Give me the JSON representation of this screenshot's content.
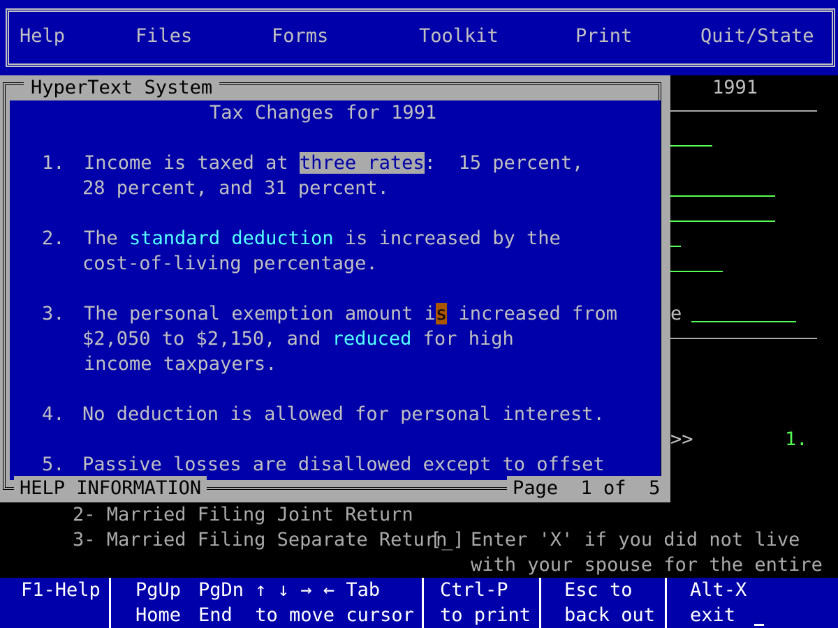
{
  "menu": {
    "items": [
      {
        "label": "Help"
      },
      {
        "label": "Files"
      },
      {
        "label": "Forms"
      },
      {
        "label": "Toolkit"
      },
      {
        "label": "Print"
      },
      {
        "label": "Quit/State"
      }
    ]
  },
  "background_form": {
    "year": "1991",
    "partial_label": "e",
    "prompt_marker": ">>",
    "line_number": "1.",
    "filing_status_2": "2- Married Filing Joint Return",
    "filing_status_3": "3- Married Filing Separate Return",
    "checkbox": "[_]",
    "instruction_line1": "Enter 'X' if you did not live",
    "instruction_line2": "with your spouse for the entire"
  },
  "help": {
    "title": "HyperText System",
    "heading": "Tax Changes for 1991",
    "item1": {
      "num": "1.",
      "pre": "Income is taxed at ",
      "link": "three rates",
      "post": ":  15 percent,",
      "line2": "28 percent, and 31 percent."
    },
    "item2": {
      "num": "2.",
      "pre": "The ",
      "link": "standard deduction",
      "post": " is increased by the",
      "line2": "cost-of-living percentage."
    },
    "item3": {
      "num": "3.",
      "pre": "The personal exemption amount i",
      "cursor_char": "s",
      "post": " increased from",
      "line2_pre": "$2,050 to $2,150, and ",
      "line2_link": "reduced",
      "line2_post": " for high",
      "line3": "income taxpayers."
    },
    "item4": {
      "num": "4.",
      "text": "No deduction is allowed for personal interest."
    },
    "item5": {
      "num": "5.",
      "text": "Passive losses are disallowed except to offset"
    },
    "footer_label": "HELP INFORMATION",
    "page_indicator": "Page  1 of  5"
  },
  "keybar": {
    "f1": "F1-Help",
    "pgup": "PgUp",
    "home": "Home",
    "pgdn_line1": "PgDn ↑ ↓ → ← Tab",
    "pgdn_line2": "End  to move cursor",
    "ctrlp_line1": "Ctrl-P",
    "ctrlp_line2": "to print",
    "esc_line1": "Esc to",
    "esc_line2": "back out",
    "altx_line1": "Alt-X",
    "altx_line2": "exit"
  },
  "colors": {
    "dos_blue": "#0000aa",
    "light_grey": "#c0c0c0",
    "window_grey": "#aaaaaa",
    "link_cyan": "#55ffff",
    "form_green": "#55ff55",
    "cursor_brown": "#aa5500"
  }
}
